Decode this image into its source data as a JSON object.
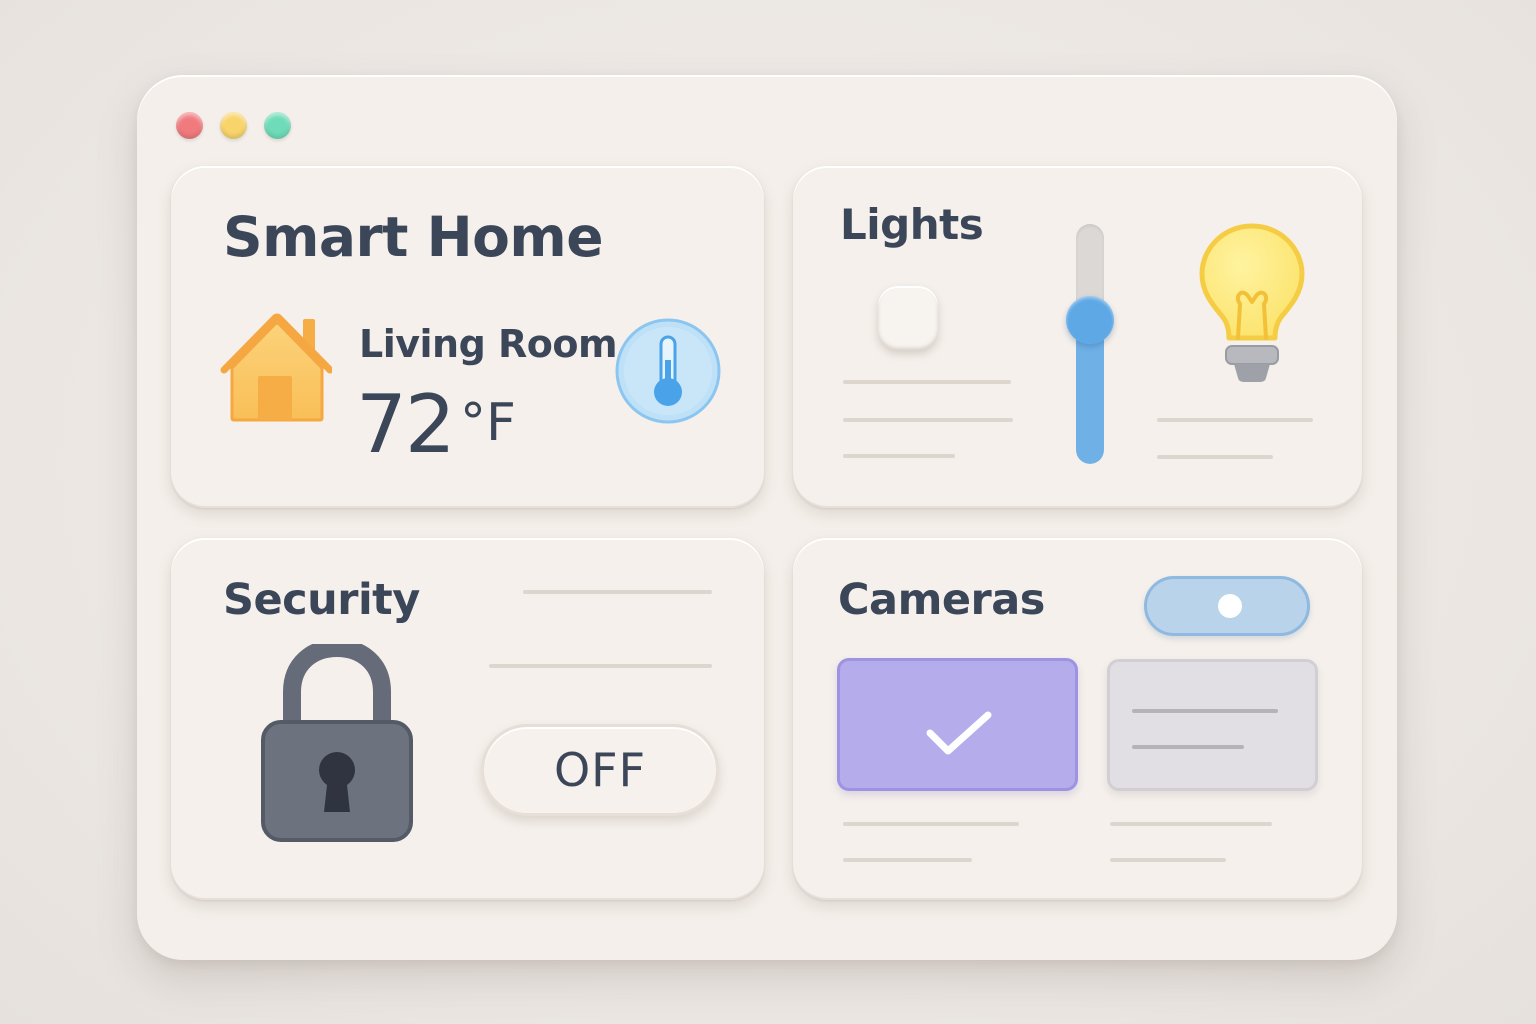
{
  "window": {
    "controls": [
      "close",
      "minimize",
      "maximize"
    ],
    "control_colors": {
      "close": "#f07a7e",
      "minimize": "#f8d46a",
      "maximize": "#6edbb9"
    }
  },
  "home_card": {
    "title": "Smart Home",
    "icon": "house-icon",
    "room": "Living Room",
    "temperature": "72",
    "temperature_unit": "°F",
    "thermostat_icon": "thermometer-icon"
  },
  "lights_card": {
    "title": "Lights",
    "switch_state": "off",
    "brightness_fraction": 0.6,
    "bulb_icon": "light-bulb-icon",
    "accent_color": "#6fb0e6",
    "bulb_color": "#fbe36b"
  },
  "security_card": {
    "title": "Security",
    "lock_icon": "padlock-icon",
    "button_label": "OFF"
  },
  "cameras_card": {
    "title": "Cameras",
    "toggle_state": "on",
    "active_tile_icon": "checkmark-icon",
    "active_tile_color": "#b4aceb",
    "toggle_color": "#b9d3ea"
  }
}
